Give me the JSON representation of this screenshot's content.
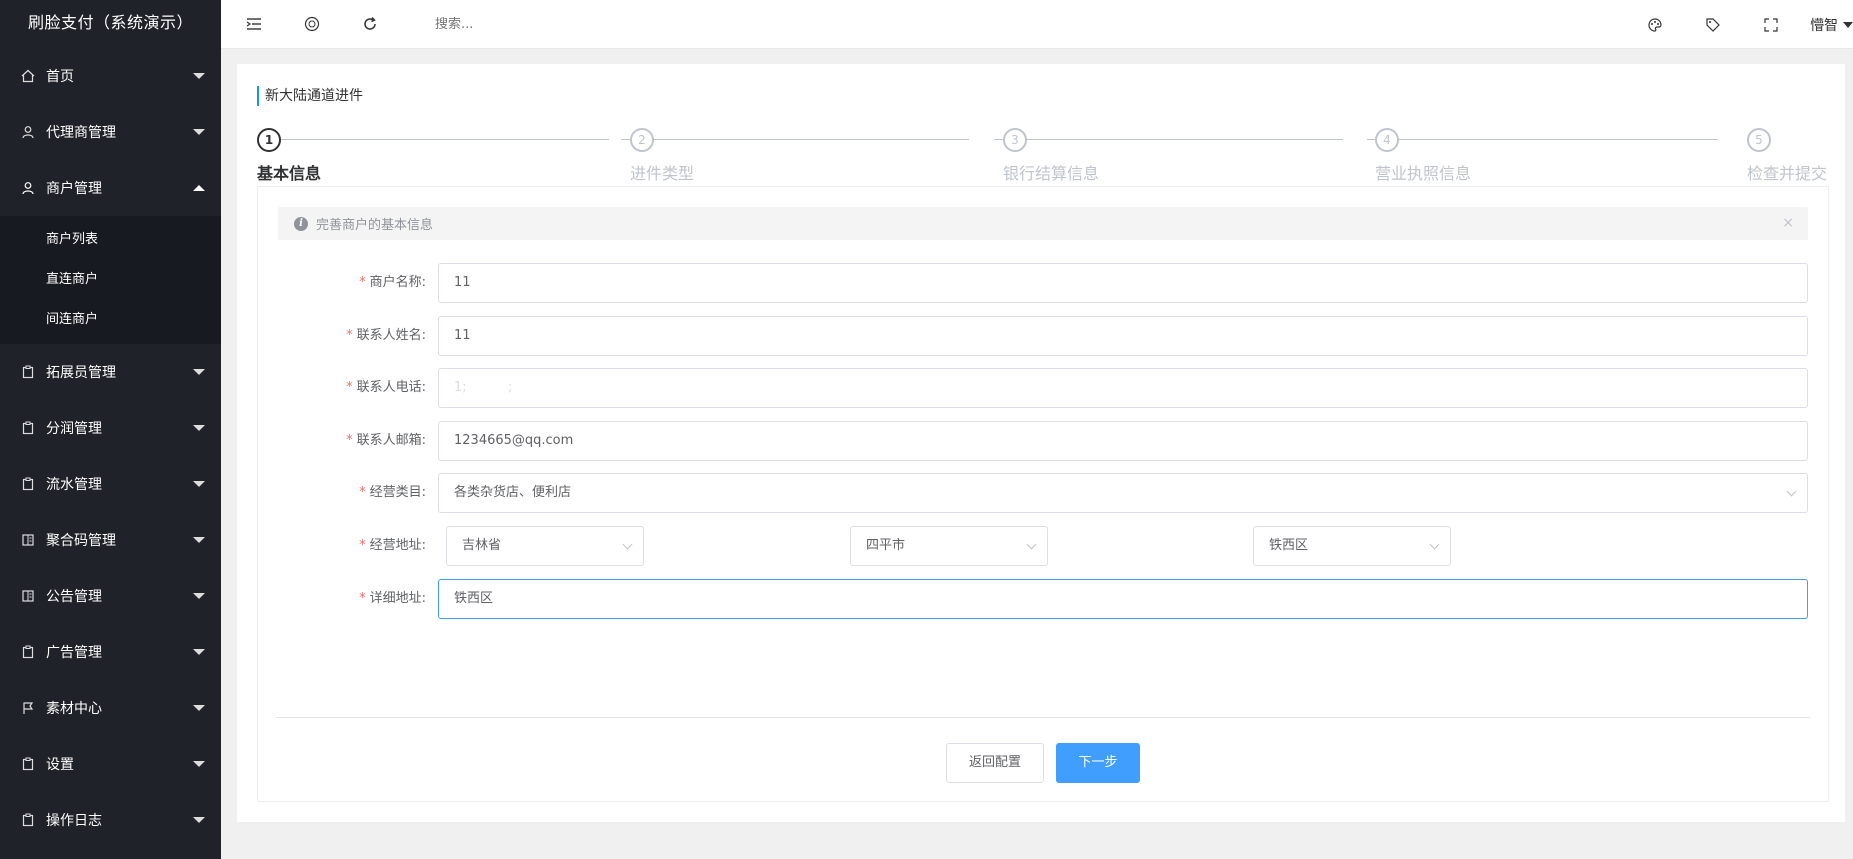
{
  "sidebar": {
    "brand": "刷脸支付（系统演示）",
    "items": [
      {
        "label": "首页",
        "icon": "home-icon"
      },
      {
        "label": "代理商管理",
        "icon": "user-icon"
      },
      {
        "label": "商户管理",
        "icon": "user-icon",
        "expanded": true
      },
      {
        "label": "拓展员管理",
        "icon": "clipboard-icon"
      },
      {
        "label": "分润管理",
        "icon": "clipboard-icon"
      },
      {
        "label": "流水管理",
        "icon": "clipboard-icon"
      },
      {
        "label": "聚合码管理",
        "icon": "book-icon"
      },
      {
        "label": "公告管理",
        "icon": "book-icon"
      },
      {
        "label": "广告管理",
        "icon": "clipboard-icon"
      },
      {
        "label": "素材中心",
        "icon": "flag-icon"
      },
      {
        "label": "设置",
        "icon": "clipboard-icon"
      },
      {
        "label": "操作日志",
        "icon": "clipboard-icon"
      }
    ],
    "submenu": [
      {
        "label": "商户列表"
      },
      {
        "label": "直连商户"
      },
      {
        "label": "间连商户"
      }
    ]
  },
  "header": {
    "search_placeholder": "搜索...",
    "user": "懵智"
  },
  "page": {
    "title": "新大陆通道进件",
    "steps": [
      {
        "num": "1",
        "label": "基本信息",
        "active": true
      },
      {
        "num": "2",
        "label": "进件类型"
      },
      {
        "num": "3",
        "label": "银行结算信息"
      },
      {
        "num": "4",
        "label": "营业执照信息"
      },
      {
        "num": "5",
        "label": "检查并提交"
      }
    ],
    "alert": "完善商户的基本信息",
    "alert_close": "×"
  },
  "form": {
    "merchant_name": {
      "label": "商户名称:",
      "value": "11"
    },
    "contact_name": {
      "label": "联系人姓名:",
      "value": "11"
    },
    "contact_phone": {
      "label": "联系人电话:",
      "value": "1;          ;"
    },
    "contact_email": {
      "label": "联系人邮箱:",
      "value": "1234665@qq.com"
    },
    "category": {
      "label": "经营类目:",
      "value": "各类杂货店、便利店"
    },
    "address": {
      "label": "经营地址:",
      "province": "吉林省",
      "city": "四平市",
      "district": "铁西区"
    },
    "detail_address": {
      "label": "详细地址:",
      "value": "铁西区"
    },
    "required_mark": "*"
  },
  "buttons": {
    "back": "返回配置",
    "next": "下一步"
  },
  "colors": {
    "sidebar_bg": "#20222a",
    "primary": "#409eff",
    "required": "#f56c6c"
  }
}
